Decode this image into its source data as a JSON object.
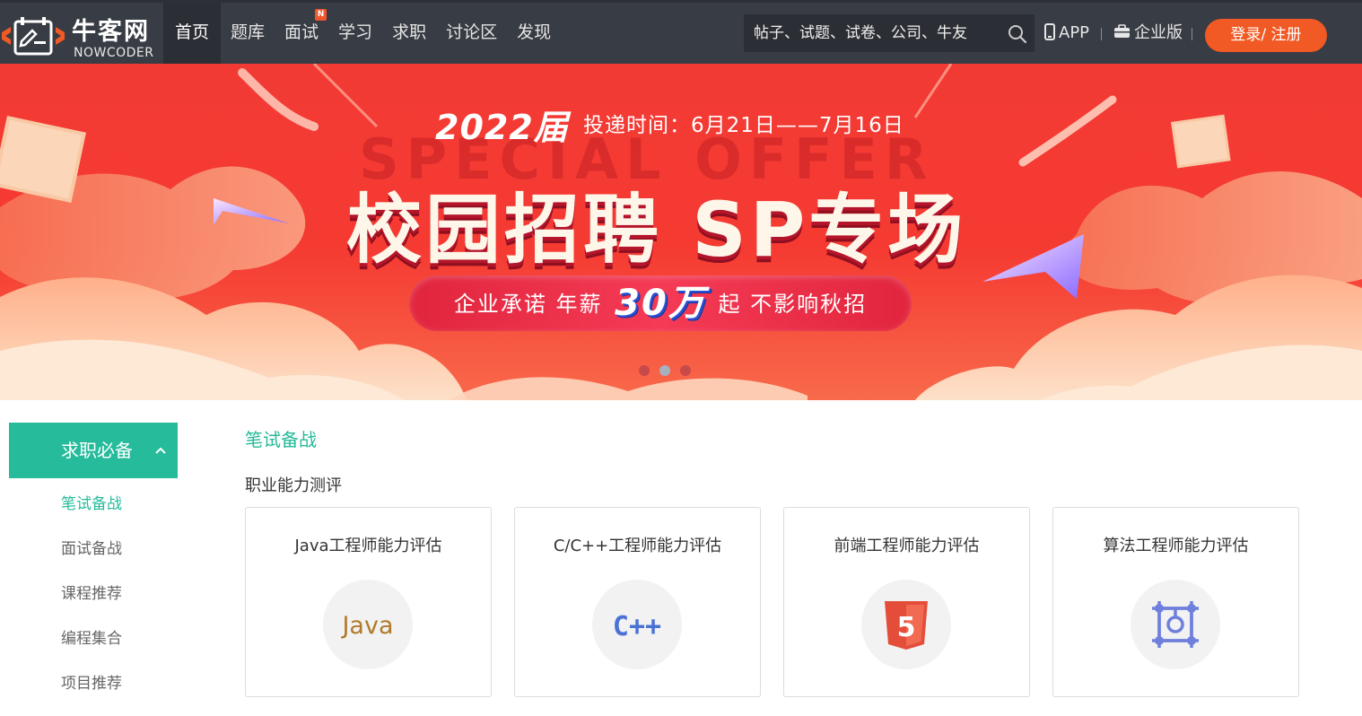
{
  "header": {
    "logo": {
      "name_cn": "牛客网",
      "name_en": "NOWCODER"
    },
    "nav": [
      {
        "label": "首页",
        "active": true
      },
      {
        "label": "题库"
      },
      {
        "label": "面试",
        "badge": "N"
      },
      {
        "label": "学习"
      },
      {
        "label": "求职"
      },
      {
        "label": "讨论区"
      },
      {
        "label": "发现"
      }
    ],
    "search": {
      "placeholder": "帖子、试题、试卷、公司、牛友",
      "icon": "search-icon"
    },
    "app_label": "APP",
    "enterprise_label": "企业版",
    "login_label": "登录/ 注册",
    "colors": {
      "bar": "#383c44",
      "active_nav": "#2b2e34",
      "login": "#f15a24"
    }
  },
  "banner": {
    "year": "2022届",
    "deliver_time": "投递时间：6月21日——7月16日",
    "bg_text": "SPECIAL OFFER",
    "title": "校园招聘 SP专场",
    "pill_prefix": "企业承诺 年薪",
    "pill_highlight": "30万",
    "pill_suffix": "起 不影响秋招",
    "dot_count": 3,
    "active_dot": 2
  },
  "sidebar": {
    "header": "求职必备",
    "items": [
      {
        "label": "笔试备战",
        "active": true
      },
      {
        "label": "面试备战"
      },
      {
        "label": "课程推荐"
      },
      {
        "label": "编程集合"
      },
      {
        "label": "项目推荐"
      }
    ],
    "accent": "#25bb9b"
  },
  "main": {
    "section_title": "笔试备战",
    "sub_title": "职业能力测评",
    "cards": [
      {
        "title": "Java工程师能力评估",
        "icon": "java-icon",
        "icon_text": "Java"
      },
      {
        "title": "C/C++工程师能力评估",
        "icon": "cpp-icon",
        "icon_text": "C++"
      },
      {
        "title": "前端工程师能力评估",
        "icon": "html5-icon",
        "icon_text": "5"
      },
      {
        "title": "算法工程师能力评估",
        "icon": "algorithm-icon"
      }
    ]
  }
}
